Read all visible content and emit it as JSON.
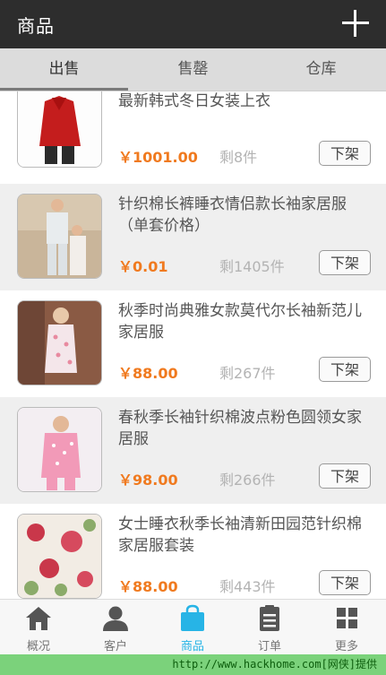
{
  "header": {
    "title": "商品",
    "add_icon": "plus-icon"
  },
  "tabs": [
    {
      "label": "出售",
      "active": true
    },
    {
      "label": "售罄",
      "active": false
    },
    {
      "label": "仓库",
      "active": false
    }
  ],
  "products": [
    {
      "name": "最新韩式冬日女装上衣",
      "price": "￥1001.00",
      "stock": "剩8件",
      "action": "下架"
    },
    {
      "name": "针织棉长裤睡衣情侣款长袖家居服（单套价格）",
      "price": "￥0.01",
      "stock": "剩1405件",
      "action": "下架"
    },
    {
      "name": "秋季时尚典雅女款莫代尔长袖新范儿家居服",
      "price": "￥88.00",
      "stock": "剩267件",
      "action": "下架"
    },
    {
      "name": "春秋季长袖针织棉波点粉色圆领女家居服",
      "price": "￥98.00",
      "stock": "剩266件",
      "action": "下架"
    },
    {
      "name": "女士睡衣秋季长袖清新田园范针织棉家居服套装",
      "price": "￥88.00",
      "stock": "剩443件",
      "action": "下架"
    }
  ],
  "bottom_nav": [
    {
      "label": "概况",
      "icon": "home-icon",
      "active": false
    },
    {
      "label": "客户",
      "icon": "person-icon",
      "active": false
    },
    {
      "label": "商品",
      "icon": "bag-icon",
      "active": true
    },
    {
      "label": "订单",
      "icon": "clipboard-icon",
      "active": false
    },
    {
      "label": "更多",
      "icon": "grid-icon",
      "active": false
    }
  ],
  "watermark": "http://www.hackhome.com[网侠]提供",
  "colors": {
    "topbar": "#2d2d2d",
    "price": "#f07a1f",
    "nav_active": "#27b4e6",
    "nav_inactive": "#777777"
  }
}
